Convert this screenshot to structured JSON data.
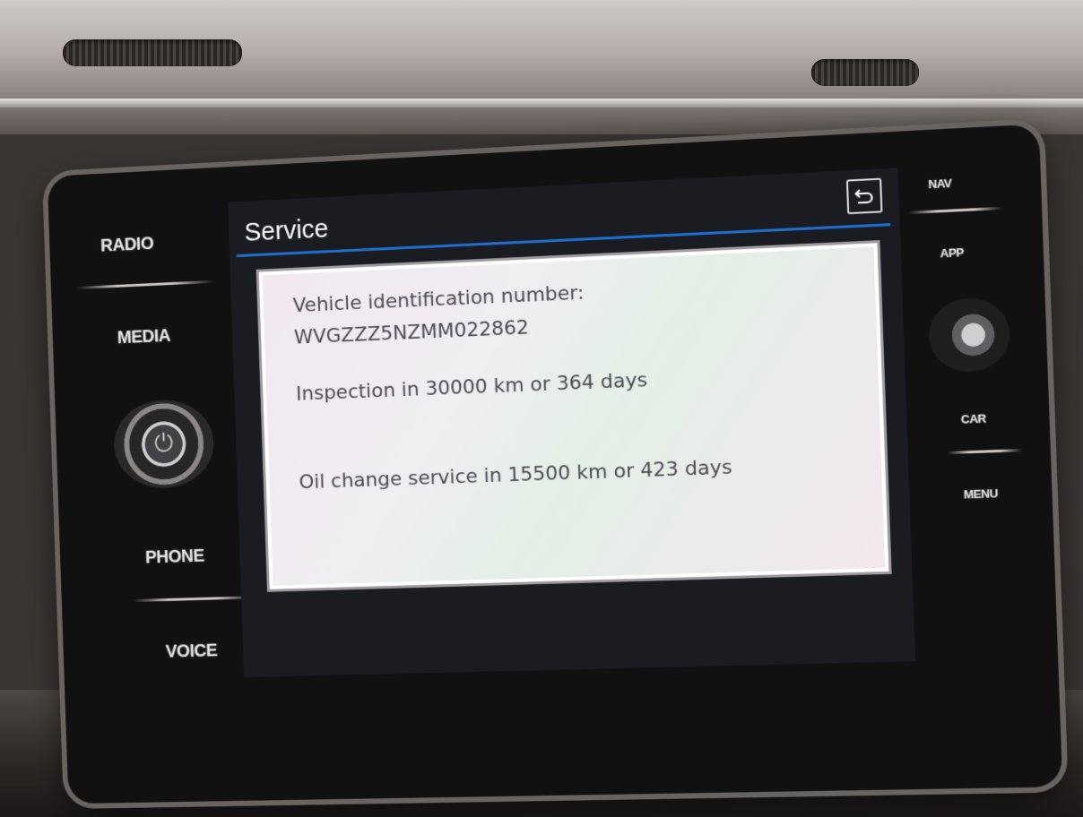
{
  "side_buttons": {
    "left": [
      "RADIO",
      "MEDIA",
      "PHONE",
      "VOICE"
    ],
    "right": [
      "NAV",
      "APP",
      "CAR",
      "MENU"
    ]
  },
  "screen": {
    "title": "Service",
    "back_icon": "back-arrow-icon",
    "accent_color": "#1f6fd0",
    "panel": {
      "vin_label": "Vehicle identification number:",
      "vin_value": "WVGZZZ5NZMM022862",
      "inspection": "Inspection in 30000 km or 364 days",
      "oil_change": "Oil change service in 15500 km or 423 days"
    }
  },
  "knobs": {
    "power_icon": "power-icon",
    "power_glyph": "⏻"
  }
}
